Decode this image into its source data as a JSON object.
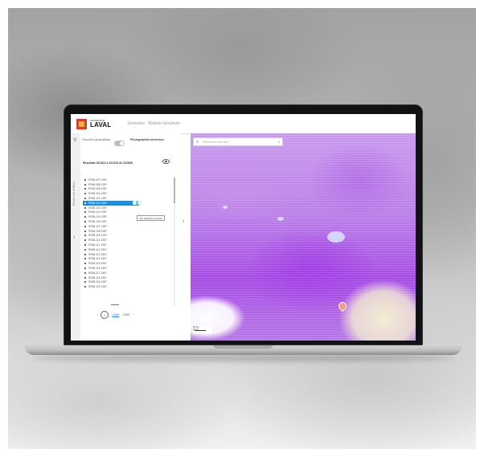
{
  "app": {
    "logo_small": "UNIVERSITÉ",
    "logo_big": "LAVAL",
    "title": "Géoindex · Module Géophoto"
  },
  "rail": {
    "vertical_label": "Recherche et filtres"
  },
  "toggle": {
    "left_label": "Données géospatiales",
    "right_label": "Photographies aériennes"
  },
  "results": {
    "count_text": "Résultats 322201 à 322225 de 322808"
  },
  "list": {
    "items": [
      "RS55-097 1957",
      "RS55-098 1957",
      "RS55-099 1957",
      "RS55-100 1957",
      "RS55-101 1957",
      "RS55-102 1957",
      "RS55-103 1957",
      "RS55-104 1957",
      "RS55-105 1957",
      "RS55-106 1957",
      "RS55-107 1957",
      "RS55-108 1957",
      "RS55-109 1957",
      "RS55-110 1957",
      "RS55-111 1957",
      "RS55-112 1957",
      "RS55-113 1957",
      "RS55-114 1957",
      "RS55-115 1957",
      "RS55-116 1957",
      "RS55-117 1957",
      "RS55-118 1957",
      "RS55-119 1957",
      "RS55-120 1957"
    ],
    "selected_index": 5,
    "tooltip": "Voir détail de la photo"
  },
  "pager": {
    "prev": "‹",
    "current": "1",
    "pages": "12889",
    "range": "12890",
    "next": "›"
  },
  "map": {
    "search_placeholder": "Recherche d'un lieu",
    "scale_top": "50 km",
    "scale_bottom": "20 mi"
  }
}
